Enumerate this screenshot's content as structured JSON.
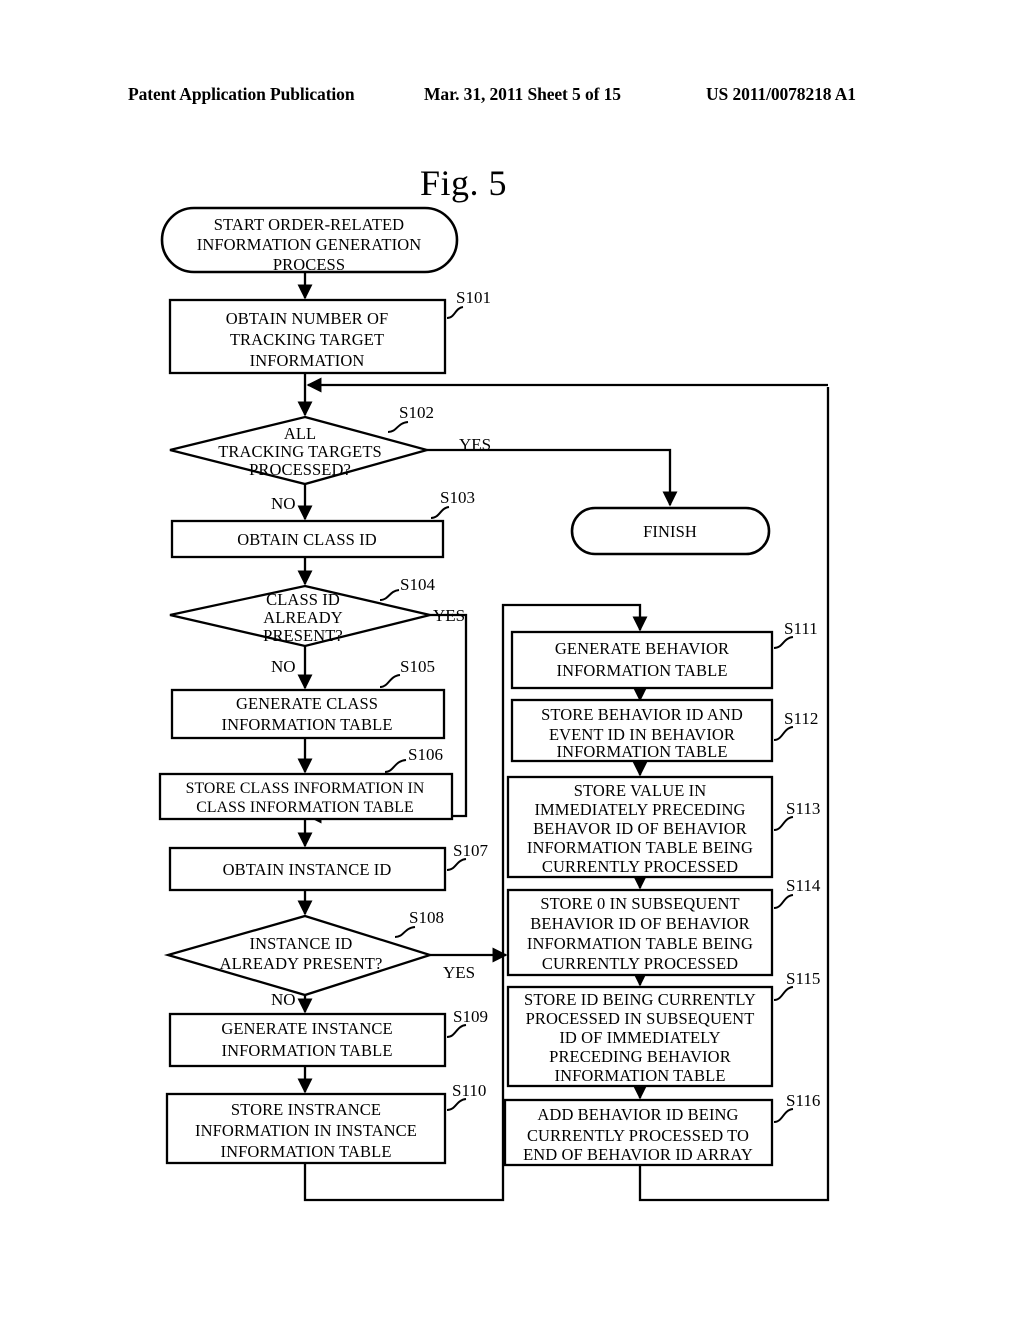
{
  "header": {
    "publication": "Patent Application Publication",
    "date_sheet": "Mar. 31, 2011  Sheet 5 of 15",
    "patent_number": "US 2011/0078218 A1"
  },
  "figure": {
    "title": "Fig. 5"
  },
  "diagram": {
    "nodes": {
      "start": {
        "label": "START ORDER-RELATED\nINFORMATION GENERATION\nPROCESS",
        "lines": [
          "START ORDER-RELATED",
          "INFORMATION GENERATION",
          "PROCESS"
        ]
      },
      "finish": {
        "label": "FINISH",
        "lines": [
          "FINISH"
        ]
      },
      "s101": {
        "step": "S101",
        "lines": [
          "OBTAIN NUMBER OF",
          "TRACKING TARGET",
          "INFORMATION"
        ]
      },
      "s102": {
        "step": "S102",
        "lines": [
          "ALL",
          "TRACKING TARGETS",
          "PROCESSED?"
        ]
      },
      "s103": {
        "step": "S103",
        "lines": [
          "OBTAIN CLASS ID"
        ]
      },
      "s104": {
        "step": "S104",
        "lines": [
          "CLASS ID",
          "ALREADY",
          "PRESENT?"
        ]
      },
      "s105": {
        "step": "S105",
        "lines": [
          "GENERATE CLASS",
          "INFORMATION TABLE"
        ]
      },
      "s106": {
        "step": "S106",
        "lines": [
          "STORE CLASS INFORMATION IN",
          "CLASS INFORMATION TABLE"
        ]
      },
      "s107": {
        "step": "S107",
        "lines": [
          "OBTAIN INSTANCE ID"
        ]
      },
      "s108": {
        "step": "S108",
        "lines": [
          "INSTANCE ID",
          "ALREADY PRESENT?"
        ]
      },
      "s109": {
        "step": "S109",
        "lines": [
          "GENERATE INSTANCE",
          "INFORMATION TABLE"
        ]
      },
      "s110": {
        "step": "S110",
        "lines": [
          "STORE INSTRANCE",
          "INFORMATION IN INSTANCE",
          "INFORMATION TABLE"
        ]
      },
      "s111": {
        "step": "S111",
        "lines": [
          "GENERATE BEHAVIOR",
          "INFORMATION TABLE"
        ]
      },
      "s112": {
        "step": "S112",
        "lines": [
          "STORE BEHAVIOR ID AND",
          "EVENT ID IN BEHAVIOR",
          "INFORMATION TABLE"
        ]
      },
      "s113": {
        "step": "S113",
        "lines": [
          "STORE VALUE IN",
          "IMMEDIATELY PRECEDING",
          "BEHAVOR ID OF BEHAVIOR",
          "INFORMATION TABLE BEING",
          "CURRENTLY PROCESSED"
        ]
      },
      "s114": {
        "step": "S114",
        "lines": [
          "STORE 0 IN SUBSEQUENT",
          "BEHAVIOR ID OF BEHAVIOR",
          "INFORMATION TABLE BEING",
          "CURRENTLY PROCESSED"
        ]
      },
      "s115": {
        "step": "S115",
        "lines": [
          "STORE ID BEING CURRENTLY",
          "PROCESSED IN SUBSEQUENT",
          "ID OF IMMEDIATELY",
          "PRECEDING BEHAVIOR",
          "INFORMATION TABLE"
        ]
      },
      "s116": {
        "step": "S116",
        "lines": [
          "ADD BEHAVIOR ID BEING",
          "CURRENTLY PROCESSED TO",
          "END OF BEHAVIOR ID ARRAY"
        ]
      }
    },
    "branches": {
      "s102_yes": "YES",
      "s102_no": "NO",
      "s104_yes": "YES",
      "s104_no": "NO",
      "s108_yes": "YES",
      "s108_no": "NO"
    },
    "colors": {
      "stroke": "#000000",
      "fill": "#ffffff",
      "background": "#ffffff"
    }
  }
}
